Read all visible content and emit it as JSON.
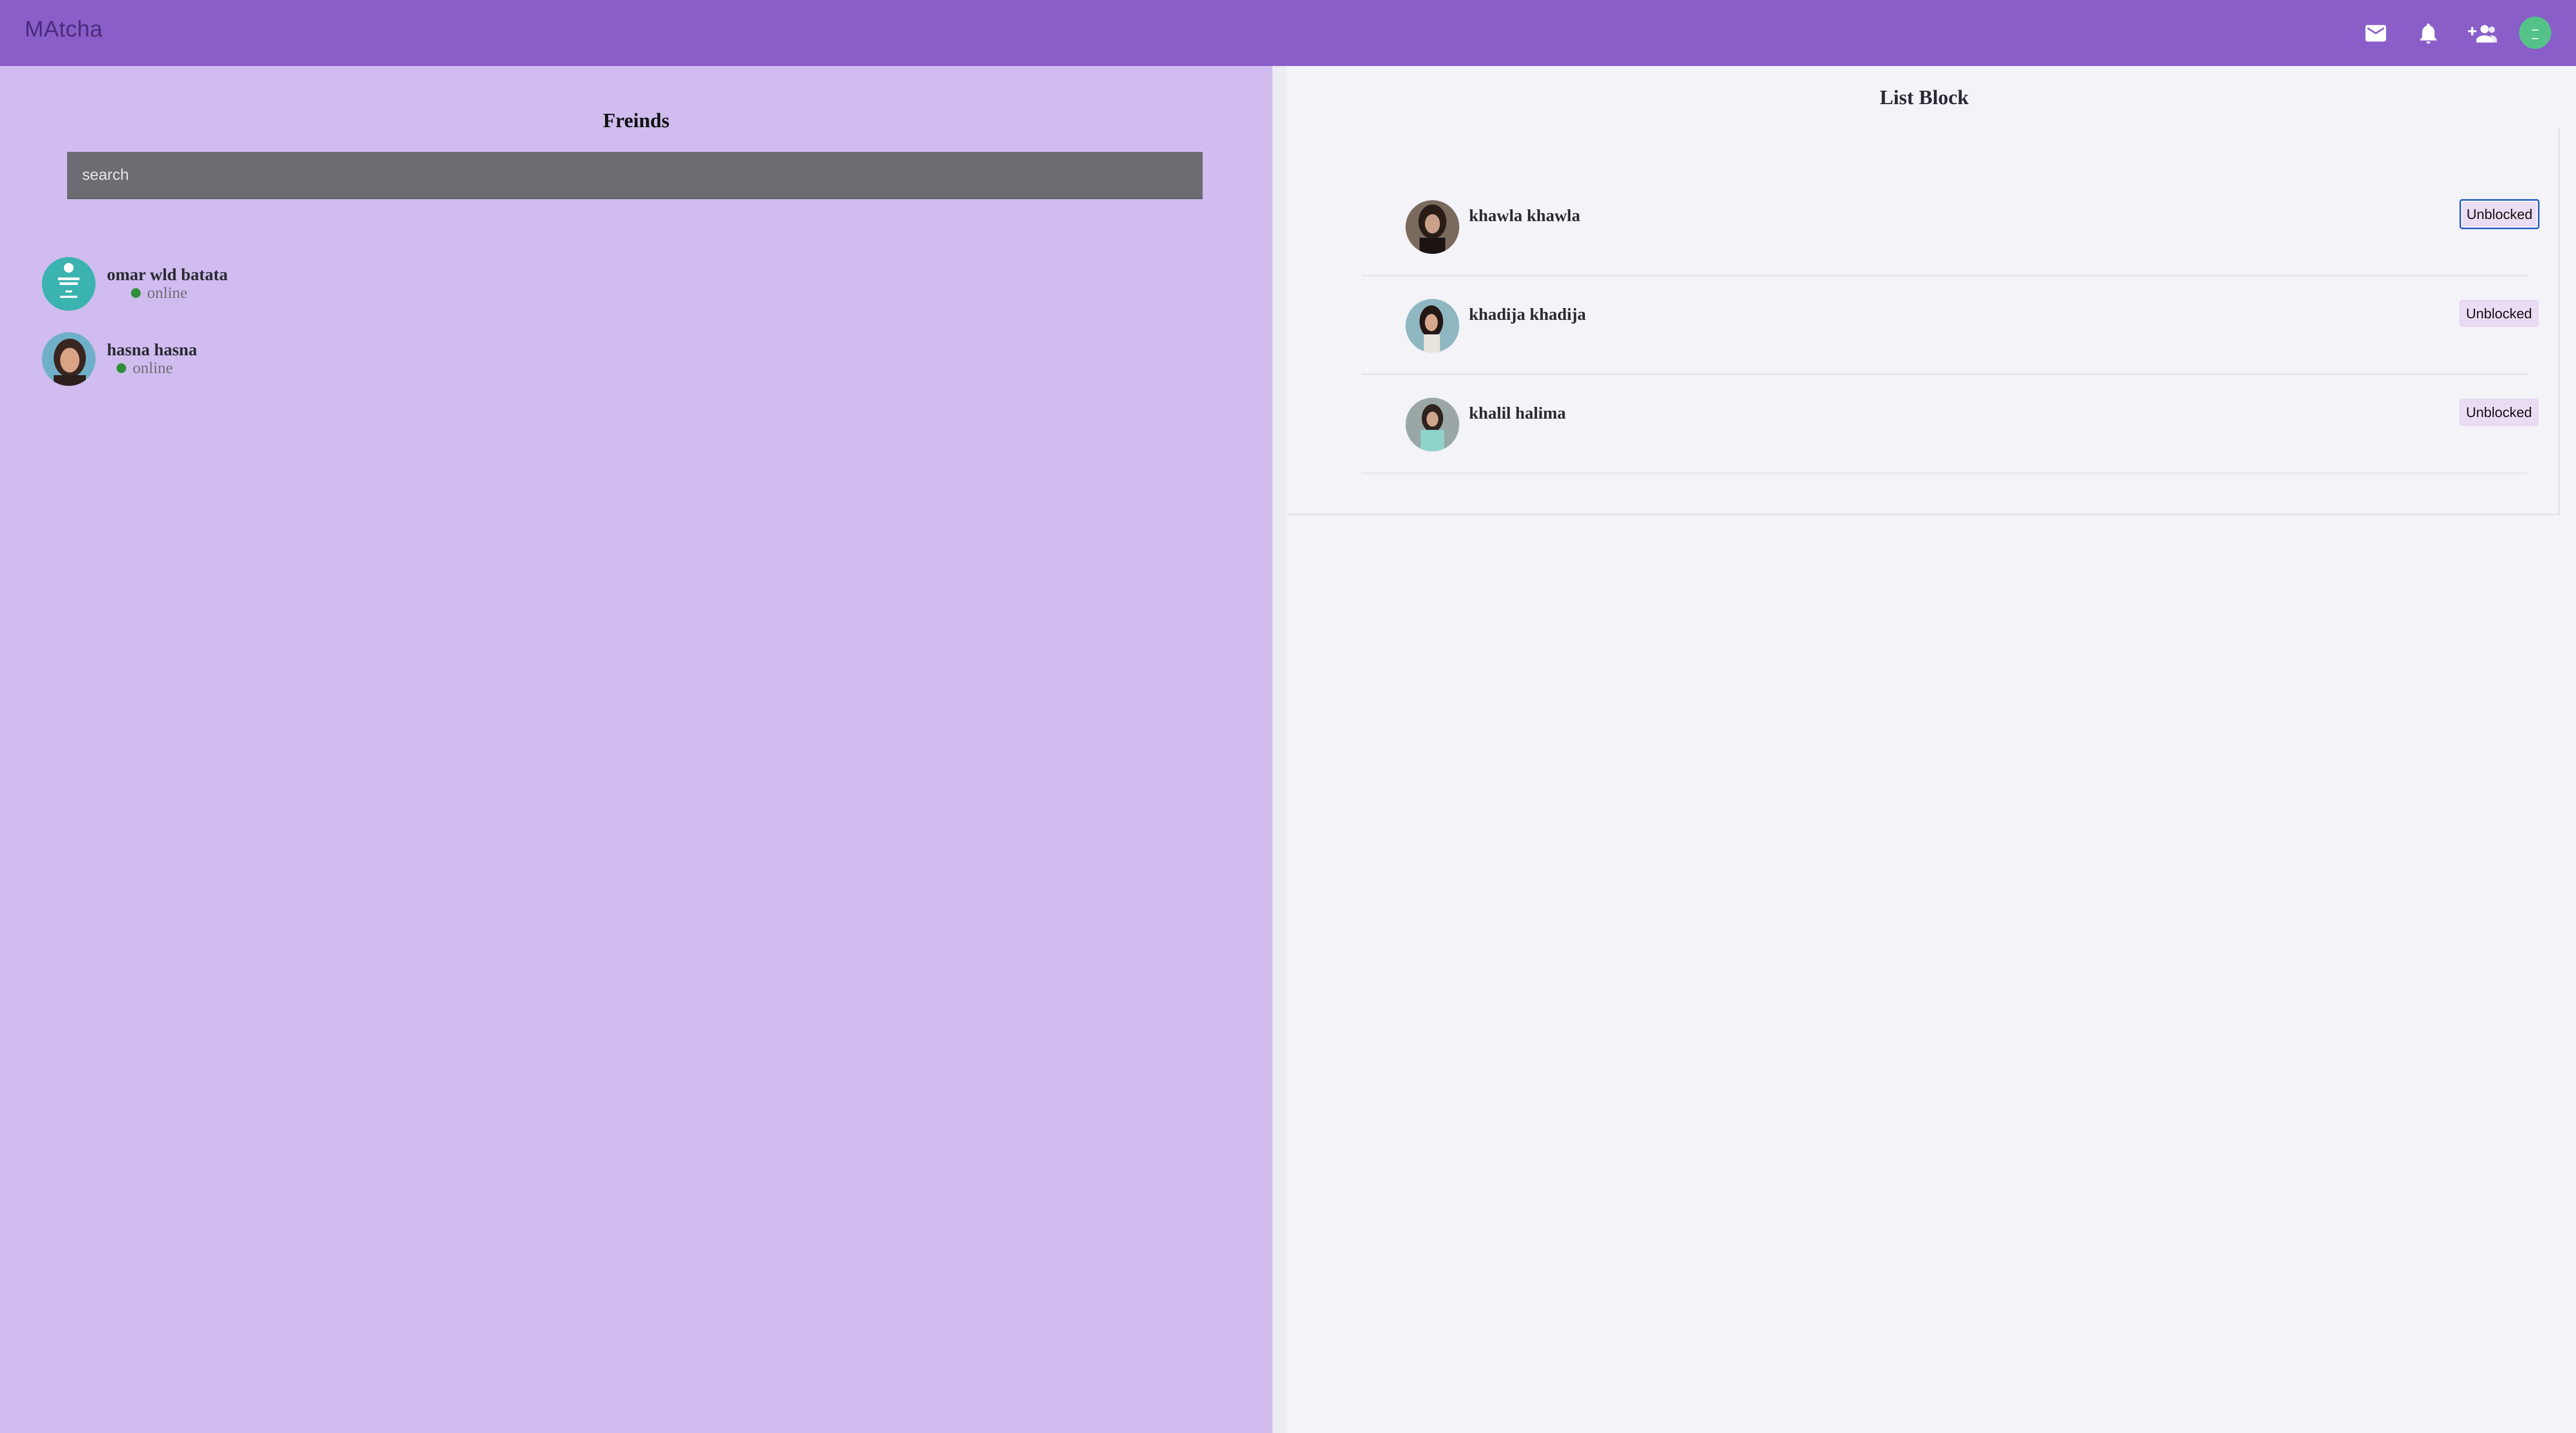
{
  "header": {
    "brand": "MAtcha",
    "icons": [
      "mail-icon",
      "bell-icon",
      "group-add-icon",
      "avatar"
    ],
    "background_color": "#8a5ec9"
  },
  "friends_panel": {
    "title": "Freinds",
    "search_placeholder": "search",
    "friends": [
      {
        "name": "omar wld batata",
        "status": "online"
      },
      {
        "name": "hasna hasna",
        "status": "online"
      }
    ],
    "background_color": "#d0bcef",
    "status_color": "#2f8f38"
  },
  "block_panel": {
    "title": "List Block",
    "blocked_users": [
      {
        "name": "khawla khawla",
        "action_label": "Unblocked"
      },
      {
        "name": "khadija khadija",
        "action_label": "Unblocked"
      },
      {
        "name": "khalil halima",
        "action_label": "Unblocked"
      }
    ]
  }
}
